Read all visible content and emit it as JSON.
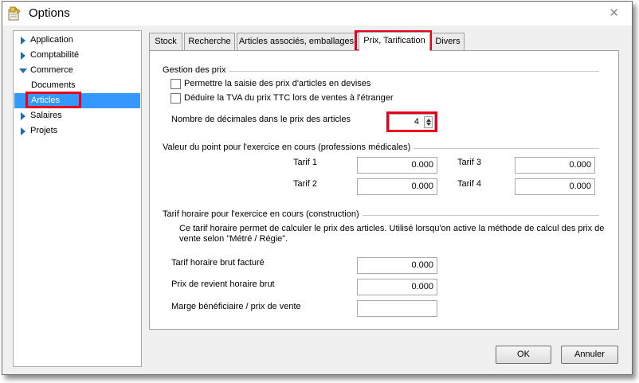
{
  "window": {
    "title": "Options",
    "close_glyph": "✕",
    "app_icon": "application-icon"
  },
  "tree": {
    "items": [
      {
        "label": "Application",
        "expand": "collapsed"
      },
      {
        "label": "Comptabilité",
        "expand": "collapsed"
      },
      {
        "label": "Commerce",
        "expand": "expanded"
      },
      {
        "label": "Documents",
        "expand": "none"
      },
      {
        "label": "Articles",
        "expand": "none",
        "selected": true
      },
      {
        "label": "Salaires",
        "expand": "collapsed"
      },
      {
        "label": "Projets",
        "expand": "collapsed"
      }
    ]
  },
  "tabs": [
    {
      "label": "Stock"
    },
    {
      "label": "Recherche"
    },
    {
      "label": "Articles associés, emballages"
    },
    {
      "label": "Prix, Tarification",
      "active": true
    },
    {
      "label": "Divers"
    }
  ],
  "gestion": {
    "title": "Gestion des prix",
    "checkbox1": "Permettre la saisie des prix d'articles en devises",
    "checkbox2": "Déduire la TVA du prix TTC lors de ventes à l'étranger",
    "decimals_label": "Nombre de décimales dans le prix des articles",
    "decimals_value": "4"
  },
  "valeur": {
    "title": "Valeur du point pour l'exercice en cours (professions médicales)",
    "tarif1_label": "Tarif 1",
    "tarif1_value": "0.000",
    "tarif2_label": "Tarif 2",
    "tarif2_value": "0.000",
    "tarif3_label": "Tarif 3",
    "tarif3_value": "0.000",
    "tarif4_label": "Tarif 4",
    "tarif4_value": "0.000"
  },
  "horaire": {
    "title": "Tarif horaire pour l'exercice en cours (construction)",
    "desc_line1": "Ce tarif horaire permet de calculer le prix des articles. Utilisé lorsqu'on active la méthode de calcul des prix de",
    "desc_line2": "vente selon \"Métré / Régie\".",
    "brut_label": "Tarif horaire brut facturé",
    "brut_value": "0.000",
    "revient_label": "Prix de revient horaire brut",
    "revient_value": "0.000",
    "marge_label": "Marge bénéficiaire / prix de vente",
    "marge_value": ""
  },
  "buttons": {
    "ok": "OK",
    "cancel": "Annuler"
  },
  "colors": {
    "highlight": "#e8001c",
    "selection": "#3399ff",
    "tree_arrow": "#1a6fb8"
  }
}
